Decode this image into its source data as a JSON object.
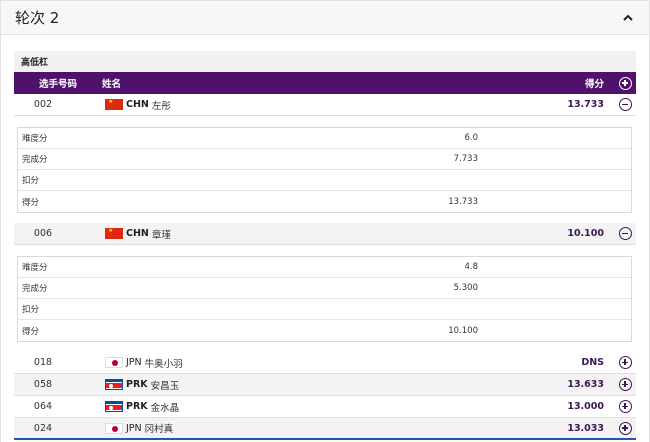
{
  "round": {
    "title": "轮次 2"
  },
  "apparatus": "高低杠",
  "table": {
    "headers": {
      "bib": "选手号码",
      "name": "姓名",
      "score": "得分"
    }
  },
  "rows": [
    {
      "bib": "002",
      "noc": "CHN",
      "flag": "chn",
      "name": "左彤",
      "score": "13.733",
      "expanded": true,
      "detail": [
        {
          "label": "难度分",
          "value": "6.0"
        },
        {
          "label": "完成分",
          "value": "7.733"
        },
        {
          "label": "扣分",
          "value": ""
        },
        {
          "label": "得分",
          "value": "13.733"
        }
      ]
    },
    {
      "bib": "006",
      "noc": "CHN",
      "flag": "chn",
      "name": "章瑾",
      "score": "10.100",
      "expanded": true,
      "detail": [
        {
          "label": "难度分",
          "value": "4.8"
        },
        {
          "label": "完成分",
          "value": "5.300"
        },
        {
          "label": "扣分",
          "value": ""
        },
        {
          "label": "得分",
          "value": "10.100"
        }
      ]
    },
    {
      "bib": "018",
      "noc": "JPN",
      "flag": "jpn",
      "name": "牛奥小羽",
      "score": "DNS",
      "expanded": false
    },
    {
      "bib": "058",
      "noc": "PRK",
      "flag": "prk",
      "name": "安昌玉",
      "score": "13.633",
      "expanded": false
    },
    {
      "bib": "064",
      "noc": "PRK",
      "flag": "prk",
      "name": "金水晶",
      "score": "13.000",
      "expanded": false
    },
    {
      "bib": "024",
      "noc": "JPN",
      "flag": "jpn",
      "name": "冈村真",
      "score": "13.033",
      "expanded": false
    }
  ]
}
